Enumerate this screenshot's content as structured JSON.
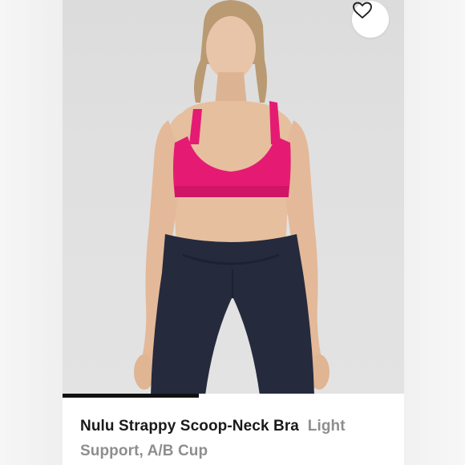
{
  "listing": {
    "product_name": "Nulu Strappy Scoop-Neck Bra",
    "variant": "Light Support, A/B Cup"
  },
  "gallery": {
    "progress": 0.4,
    "favorite_icon": "heart-icon"
  },
  "colors": {
    "bra": "#e51b73",
    "leggings": "#262a3d",
    "progress": "#111111",
    "variant_text": "#8e8e8e"
  }
}
